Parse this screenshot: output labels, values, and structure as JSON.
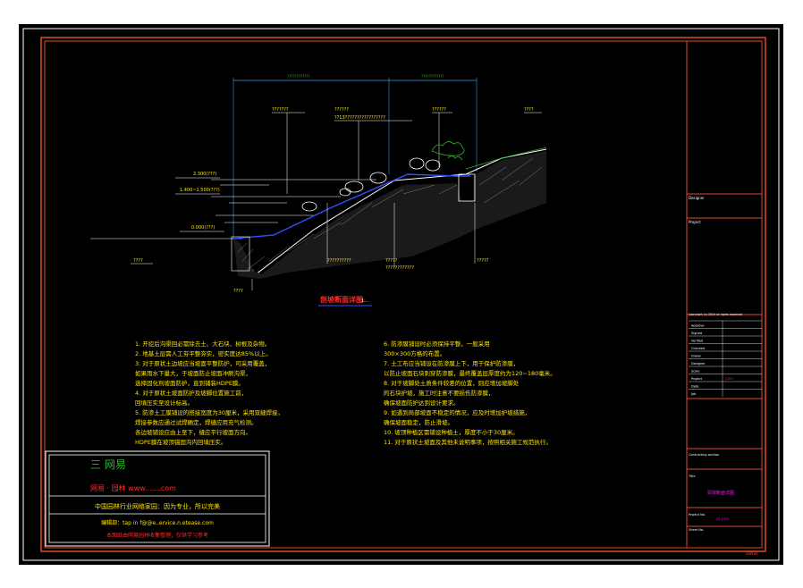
{
  "section": {
    "title": "剖坡断面详图",
    "scale": "1:..",
    "dim_top_left": "????????????",
    "dim_top_right": "????????????",
    "label_a": "???????",
    "label_b": "??????",
    "label_c": "??????????????",
    "label_d": "??13?????????????????",
    "label_e": "??????????????",
    "label_f": "??????",
    "label_g": "????",
    "level_1": "2.300(???)",
    "level_2": "1.400~1.500(???)",
    "level_3": "0.000(???)",
    "label_left_bottom": "????",
    "label_bottom_1": "????",
    "label_bottom_2": "??????????",
    "label_bottom_3": "?????",
    "label_bottom_4": "????????????",
    "label_bottom_5": "?????"
  },
  "notes_left": [
    "1. 开挖后沟渠回必需除去土、大石块、树根及杂物。",
    "2. 地基土层需人工夯平整夯实，密实度达85%以上。",
    "3. 对于原状土边坡应当坡面平整防护，可采用覆盖，",
    "如果雨水下量大，于坡面防止坡面冲刷沟渠，",
    "选择固化剂坡面防护，直到铺装HDPE膜。",
    "4. 对于原状土坡面防护及坡脚位置施工前，",
    "回填压实至设计标高。",
    "5. 防渗土工膜铺设的搭接宽度为30厘米，采用双缝焊接，",
    "焊接参数应通过试焊确定，焊缝应用充气检测。",
    "各边坡铺设应由上至下，缝应平行坡面方向。",
    "HDPE膜在坡顶锚固沟内回填压实。"
  ],
  "notes_right": [
    "6. 防渗膜铺设时必须保持平整，一般采用",
    "300×300方格的布置。",
    "7. 土工布应当铺设在防渗膜上下，用于保护防渗膜，",
    "以防止坡面石块刺穿防渗膜，最终覆盖层厚度约为120~180毫米。",
    "8. 对于坡脚处土质条件较差的位置，则应增加坡脚处",
    "的石块护坡，施工时注意不要损伤防渗膜，",
    "确保坡面防护达到设计要求。",
    "9. 如遇到局部坡面不稳定的情况，应及时增加护坡措施，",
    "确保坡面稳定，防止滑坡。",
    "10. 坡顶种植区需铺设种植土，厚度不小于30厘米。",
    "11. 对于原状土坡面及其他未说明事项，按照相关施工规范执行。"
  ],
  "watermark": {
    "line1": "三 网易",
    "line2": "网易 · 园林  www.......com",
    "line3": "中国园林行业网络家园：因为专业，所以完美",
    "line4": "编辑部：tap in f@@e..ervice.n.etease.com",
    "line5": "本图纸由网易园林收集整理，仅供学习参考"
  },
  "titleblock": {
    "designer": "Designer",
    "project": "Project",
    "copyright": "Copyright (c) 2019 all rights reserved",
    "approve": "Approve",
    "fields": [
      "Approve",
      "Signed",
      "Verified",
      "Checked",
      "Drawn",
      "Designer",
      "Scale",
      "Project",
      "Date",
      "Job"
    ],
    "values": [
      "",
      "",
      "",
      "",
      "",
      "",
      "",
      "1:50",
      "",
      ""
    ],
    "contracting": "Contracting section",
    "drawing_title": "Title",
    "drawing_name": "驳岸断面详图",
    "project_no_label": "Project No.",
    "project_no": "?? ????",
    "sheet_no_label": "Sheet No.",
    "sheet_no": "1 of 1",
    "footer": "GWGH"
  },
  "colors": {
    "frame": "#e04a2a",
    "line": "#ffffff",
    "dim": "#3a9ad9",
    "cyan": "#00c8d0",
    "yellow": "#ffe400",
    "magenta": "#e020e0",
    "green": "#31b231",
    "red": "#ff2a2a",
    "blue": "#3050ff"
  }
}
